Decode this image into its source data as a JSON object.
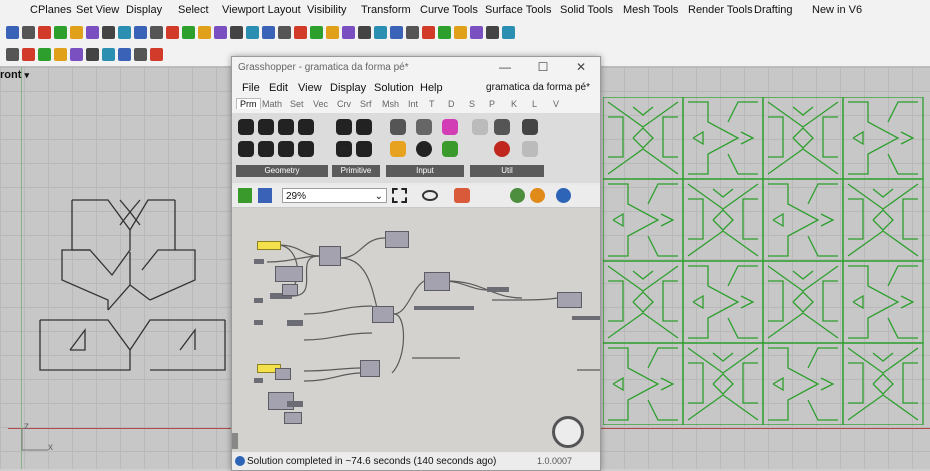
{
  "rhino": {
    "menu_tabs": [
      "CPlanes",
      "Set View",
      "Display",
      "Select",
      "Viewport Layout",
      "Visibility",
      "Transform",
      "Curve Tools",
      "Surface Tools",
      "Solid Tools",
      "Mesh Tools",
      "Render Tools",
      "Drafting",
      "New in V6"
    ],
    "viewport_name": "ront",
    "axis_labels": {
      "x": "x",
      "y": "z"
    }
  },
  "grasshopper": {
    "title": "Grasshopper - gramatica da forma pé*",
    "window_buttons": {
      "minimize": "—",
      "maximize": "☐",
      "close": "✕"
    },
    "menu": [
      "File",
      "Edit",
      "View",
      "Display",
      "Solution",
      "Help"
    ],
    "document_name": "gramatica da forma pé*",
    "tabs": [
      "Prm",
      "Math",
      "Set",
      "Vec",
      "Crv",
      "Srf",
      "Msh",
      "Int",
      "T",
      "D",
      "S",
      "P",
      "K",
      "L",
      "V"
    ],
    "ribbon_groups": [
      "Geometry",
      "Primitive",
      "Input",
      "Util"
    ],
    "zoom": "29%",
    "status": "Solution completed in ~74.6 seconds (140 seconds ago)",
    "version": "1.0.0007"
  }
}
